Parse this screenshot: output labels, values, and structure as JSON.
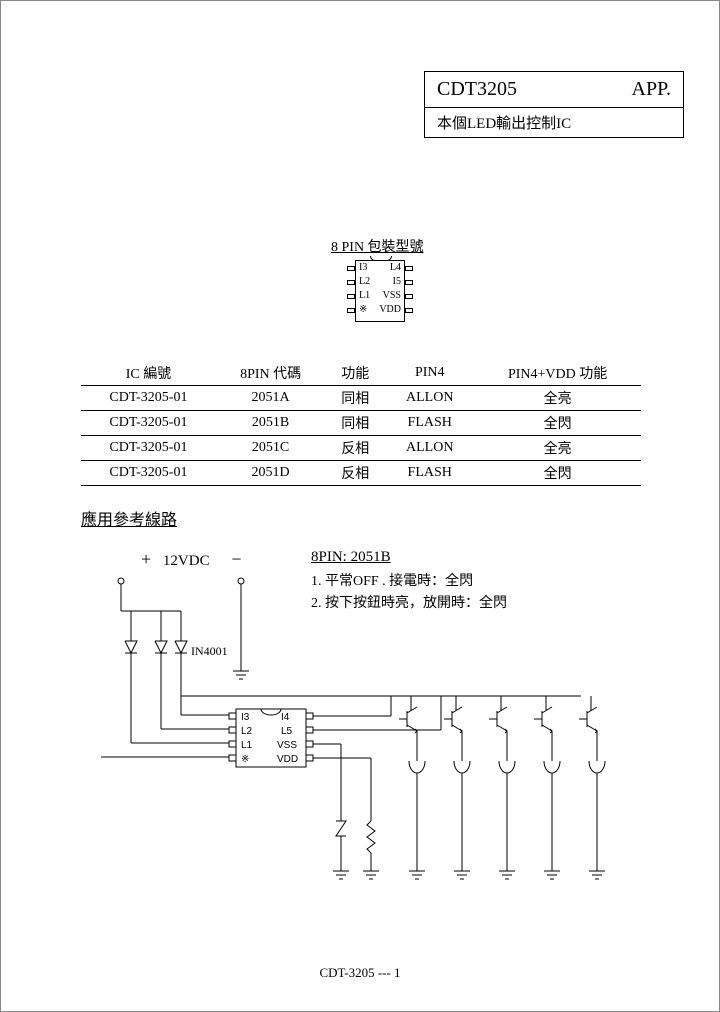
{
  "header": {
    "part": "CDT3205",
    "tag": "APP.",
    "subtitle": "本個LED輸出控制IC"
  },
  "pinout": {
    "title": "8 PIN 包裝型號",
    "pins_left": [
      "I3",
      "L2",
      "L1",
      "※"
    ],
    "pins_right": [
      "L4",
      "I5",
      "VSS",
      "VDD"
    ]
  },
  "table": {
    "headers": [
      "IC 編號",
      "8PIN 代碼",
      "功能",
      "PIN4",
      "PIN4+VDD 功能"
    ],
    "rows": [
      [
        "CDT-3205-01",
        "2051A",
        "同相",
        "ALLON",
        "全亮"
      ],
      [
        "CDT-3205-01",
        "2051B",
        "同相",
        "FLASH",
        "全閃"
      ],
      [
        "CDT-3205-01",
        "2051C",
        "反相",
        "ALLON",
        "全亮"
      ],
      [
        "CDT-3205-01",
        "2051D",
        "反相",
        "FLASH",
        "全閃"
      ]
    ]
  },
  "section_title": "應用參考線路",
  "power": {
    "label": "12VDC",
    "diode": "IN4001"
  },
  "notes": {
    "title": "8PIN: 2051B",
    "l1": "1.  平常OFF .            接電時：全閃",
    "l2": "2.  按下按鈕時亮，放開時：全閃"
  },
  "chip2": {
    "pins_left": [
      "I3",
      "L2",
      "L1",
      "※"
    ],
    "pins_right": [
      "I4",
      "L5",
      "VSS",
      "VDD"
    ]
  },
  "footer": "CDT-3205 ---    1"
}
